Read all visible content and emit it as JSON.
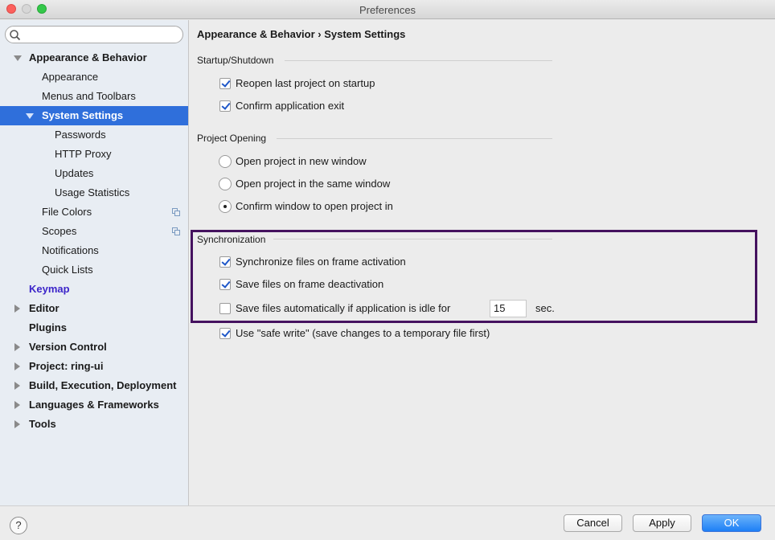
{
  "window": {
    "title": "Preferences"
  },
  "sidebar": {
    "search_placeholder": "",
    "items": [
      {
        "label": "Appearance & Behavior"
      },
      {
        "label": "Appearance"
      },
      {
        "label": "Menus and Toolbars"
      },
      {
        "label": "System Settings",
        "selected": true
      },
      {
        "label": "Passwords"
      },
      {
        "label": "HTTP Proxy"
      },
      {
        "label": "Updates"
      },
      {
        "label": "Usage Statistics"
      },
      {
        "label": "File Colors"
      },
      {
        "label": "Scopes"
      },
      {
        "label": "Notifications"
      },
      {
        "label": "Quick Lists"
      },
      {
        "label": "Keymap"
      },
      {
        "label": "Editor"
      },
      {
        "label": "Plugins"
      },
      {
        "label": "Version Control"
      },
      {
        "label": "Project: ring-ui"
      },
      {
        "label": "Build, Execution, Deployment"
      },
      {
        "label": "Languages & Frameworks"
      },
      {
        "label": "Tools"
      }
    ]
  },
  "content": {
    "breadcrumb": "Appearance & Behavior › System Settings",
    "startup": {
      "title": "Startup/Shutdown",
      "reopen_label": "Reopen last project on startup",
      "reopen_checked": true,
      "confirm_exit_label": "Confirm application exit",
      "confirm_exit_checked": true
    },
    "project_opening": {
      "title": "Project Opening",
      "options": [
        {
          "label": "Open project in new window",
          "selected": false
        },
        {
          "label": "Open project in the same window",
          "selected": false
        },
        {
          "label": "Confirm window to open project in",
          "selected": true
        }
      ]
    },
    "sync": {
      "title": "Synchronization",
      "sync_files_label": "Synchronize files on frame activation",
      "sync_files_checked": true,
      "save_deactivation_label": "Save files on frame deactivation",
      "save_deactivation_checked": true,
      "save_idle_label": "Save files automatically if application is idle for",
      "save_idle_checked": false,
      "idle_seconds": "15",
      "sec_label": "sec.",
      "highlight_color": "#45125f"
    },
    "safe_write_label": "Use \"safe write\" (save changes to a temporary file first)",
    "safe_write_checked": true
  },
  "footer": {
    "help_label": "?",
    "cancel_label": "Cancel",
    "apply_label": "Apply",
    "ok_label": "OK"
  }
}
